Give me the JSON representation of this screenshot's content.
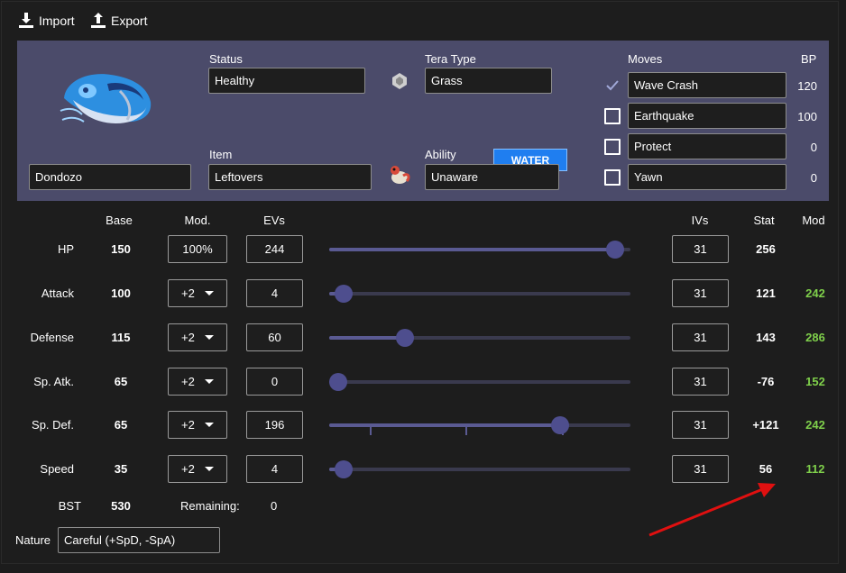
{
  "toolbar": {
    "import_label": "Import",
    "export_label": "Export"
  },
  "pokemon": {
    "name": "Dondozo"
  },
  "status": {
    "label": "Status",
    "value": "Healthy"
  },
  "tera": {
    "label": "Tera Type",
    "value": "Grass",
    "button_label": "WATER",
    "button_color": "#1f7ef0"
  },
  "item": {
    "label": "Item",
    "value": "Leftovers"
  },
  "ability": {
    "label": "Ability",
    "value": "Unaware"
  },
  "moves": {
    "label": "Moves",
    "bp_label": "BP",
    "list": [
      {
        "name": "Wave Crash",
        "bp": "120",
        "checked": true
      },
      {
        "name": "Earthquake",
        "bp": "100",
        "checked": false
      },
      {
        "name": "Protect",
        "bp": "0",
        "checked": false
      },
      {
        "name": "Yawn",
        "bp": "0",
        "checked": false
      }
    ]
  },
  "headers": {
    "base": "Base",
    "mod": "Mod.",
    "evs": "EVs",
    "ivs": "IVs",
    "stat": "Stat",
    "mod_col": "Mod"
  },
  "stats": [
    {
      "name": "HP",
      "base": "150",
      "mod": "100%",
      "ev": "244",
      "iv": "31",
      "stat": "256",
      "modval": "",
      "ev_fraction": 0.96
    },
    {
      "name": "Attack",
      "base": "100",
      "mod": "+2",
      "ev": "4",
      "iv": "31",
      "stat": "121",
      "modval": "242",
      "ev_fraction": 0.02
    },
    {
      "name": "Defense",
      "base": "115",
      "mod": "+2",
      "ev": "60",
      "iv": "31",
      "stat": "143",
      "modval": "286",
      "ev_fraction": 0.23
    },
    {
      "name": "Sp. Atk.",
      "base": "65",
      "mod": "+2",
      "ev": "0",
      "iv": "31",
      "stat": "-76",
      "modval": "152",
      "ev_fraction": 0.0
    },
    {
      "name": "Sp. Def.",
      "base": "65",
      "mod": "+2",
      "ev": "196",
      "iv": "31",
      "stat": "+121",
      "modval": "242",
      "ev_fraction": 0.77
    },
    {
      "name": "Speed",
      "base": "35",
      "mod": "+2",
      "ev": "4",
      "iv": "31",
      "stat": "56",
      "modval": "112",
      "ev_fraction": 0.02
    }
  ],
  "footer": {
    "bst_label": "BST",
    "bst_value": "530",
    "remaining_label": "Remaining:",
    "remaining_value": "0"
  },
  "nature": {
    "label": "Nature",
    "value": "Careful (+SpD, -SpA)"
  },
  "colors": {
    "panel": "#4b4b6a",
    "mod_positive": "#7fd04b",
    "arrow": "#e01010",
    "slider_thumb": "#4e4e8e"
  }
}
